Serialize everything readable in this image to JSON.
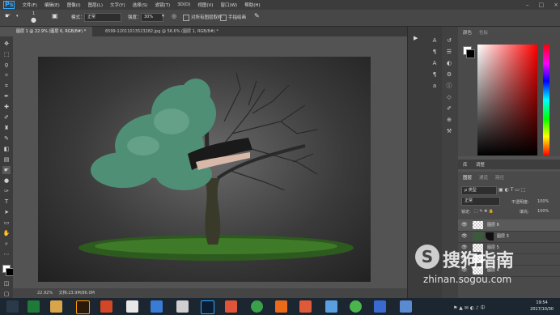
{
  "app": {
    "logo": "Ps"
  },
  "menu": [
    "文件(F)",
    "编辑(E)",
    "图像(I)",
    "图层(L)",
    "文字(Y)",
    "选择(S)",
    "滤镜(T)",
    "3D(D)",
    "视图(V)",
    "窗口(W)",
    "帮助(H)"
  ],
  "options": {
    "brush_size": "1",
    "mode_label": "模式：",
    "mode_value": "正常",
    "strength_label": "强度：",
    "strength_value": "30%",
    "sample_all": "对所有图层取样",
    "finger_paint": "手指绘画"
  },
  "tabs": [
    {
      "label": "图层 1 @ 22.9% (图层 6, RGB/8#) *",
      "close": "×"
    },
    {
      "label": "6599-12011013523282.jpg @ 56.6% (图层 1, RGB/8#) *",
      "close": "×"
    }
  ],
  "status": {
    "zoom": "22.92%",
    "doc": "文档:23.9M/86.0M"
  },
  "panels": {
    "color_tab": "颜色",
    "swatch_tab": "色板",
    "library_tab": "库",
    "adjust_tab": "调整",
    "layers_tab": "图层",
    "channels_tab": "通道",
    "paths_tab": "路径",
    "kind_label": "ρ 类型",
    "blend": "正常",
    "opacity_label": "不透明度:",
    "opacity": "100%",
    "lock_label": "锁定:",
    "fill_label": "填充:",
    "fill": "100%"
  },
  "layers": [
    {
      "name": "图层 6",
      "selected": true
    },
    {
      "name": "图层 3",
      "selected": false
    },
    {
      "name": "图层 5",
      "selected": false
    },
    {
      "name": "图层 2",
      "selected": false
    },
    {
      "name": "图层 4",
      "selected": false
    }
  ],
  "watermark": {
    "logo": "S",
    "brand": "搜狗指南",
    "url": "zhinan.sogou.com"
  },
  "clock": {
    "time": "19:54",
    "date": "2017/10/30"
  },
  "colors": {
    "accent": "#31a8ff",
    "ui_dark": "#3c3c3c",
    "taskbar": "#1b2630"
  }
}
